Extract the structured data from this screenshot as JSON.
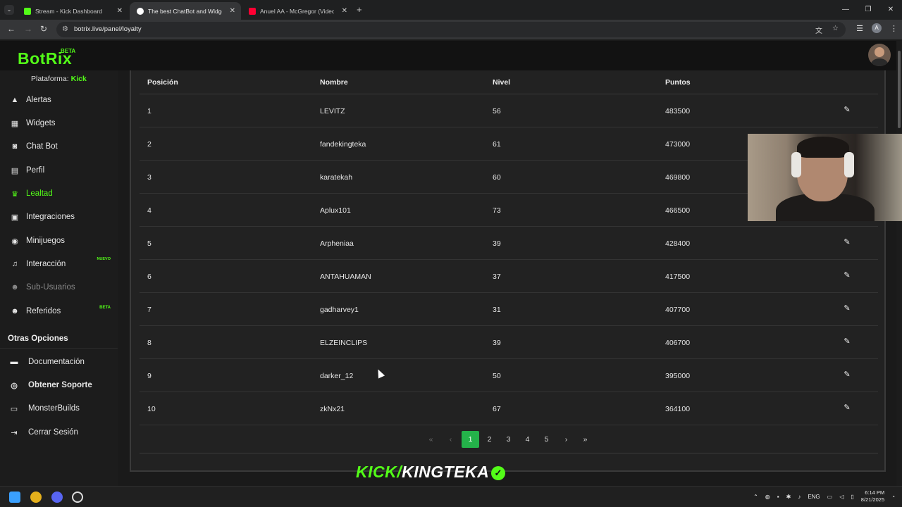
{
  "browser": {
    "tabs": [
      {
        "title": "Stream - Kick Dashboard",
        "favicon_color": "#53fc18"
      },
      {
        "title": "The best ChatBot and Widgets",
        "favicon_color": "#ffffff"
      },
      {
        "title": "Anuel AA - McGregor (Video O",
        "favicon_color": "#ff0033"
      }
    ],
    "url": "botrix.live/panel/loyalty",
    "profile_initial": "A"
  },
  "site": {
    "logo": "BotRix",
    "logo_badge": "BETA",
    "platform_label": "Plataforma:",
    "platform_value": "Kick"
  },
  "sidebar": {
    "items": [
      {
        "label": "Alertas",
        "icon": "warning-icon"
      },
      {
        "label": "Widgets",
        "icon": "grid-icon"
      },
      {
        "label": "Chat Bot",
        "icon": "robot-icon"
      },
      {
        "label": "Perfil",
        "icon": "id-card-icon"
      },
      {
        "label": "Lealtad",
        "icon": "trophy-icon",
        "active": true
      },
      {
        "label": "Integraciones",
        "icon": "puzzle-icon"
      },
      {
        "label": "Minijuegos",
        "icon": "gamepad-icon"
      },
      {
        "label": "Interacción",
        "icon": "music-icon",
        "badge": "NUEVO"
      },
      {
        "label": "Sub-Usuarios",
        "icon": "users-icon",
        "disabled": true
      },
      {
        "label": "Referidos",
        "icon": "users-icon",
        "badge": "BETA"
      }
    ],
    "other_title": "Otras Opciones",
    "other_items": [
      {
        "label": "Documentación",
        "icon": "book-icon"
      },
      {
        "label": "Obtener Soporte",
        "icon": "support-icon",
        "bold": true
      },
      {
        "label": "MonsterBuilds",
        "icon": "laptop-icon"
      },
      {
        "label": "Cerrar Sesión",
        "icon": "logout-icon"
      }
    ]
  },
  "table": {
    "headers": [
      "Posición",
      "Nombre",
      "Nivel",
      "Puntos"
    ],
    "rows": [
      {
        "pos": "1",
        "name": "LEVITZ",
        "level": "56",
        "points": "483500"
      },
      {
        "pos": "2",
        "name": "fandekingteka",
        "level": "61",
        "points": "473000"
      },
      {
        "pos": "3",
        "name": "karatekah",
        "level": "60",
        "points": "469800"
      },
      {
        "pos": "4",
        "name": "Aplux101",
        "level": "73",
        "points": "466500"
      },
      {
        "pos": "5",
        "name": "Arpheniaa",
        "level": "39",
        "points": "428400"
      },
      {
        "pos": "6",
        "name": "ANTAHUAMAN",
        "level": "37",
        "points": "417500"
      },
      {
        "pos": "7",
        "name": "gadharvey1",
        "level": "31",
        "points": "407700"
      },
      {
        "pos": "8",
        "name": "ELZEINCLIPS",
        "level": "39",
        "points": "406700"
      },
      {
        "pos": "9",
        "name": "darker_12",
        "level": "50",
        "points": "395000"
      },
      {
        "pos": "10",
        "name": "zkNx21",
        "level": "67",
        "points": "364100"
      }
    ]
  },
  "pagination": {
    "first": "«",
    "prev": "‹",
    "pages": [
      "1",
      "2",
      "3",
      "4",
      "5"
    ],
    "current": "1",
    "next": "›",
    "last": "»"
  },
  "overlay": {
    "kick_prefix": "KICK/",
    "channel": "KINGTEKA",
    "check": "✓"
  },
  "taskbar": {
    "lang": "ENG",
    "time": "6:14 PM",
    "date": "8/21/2025"
  },
  "colors": {
    "accent": "#53fc18",
    "page_active": "#24b24a"
  }
}
